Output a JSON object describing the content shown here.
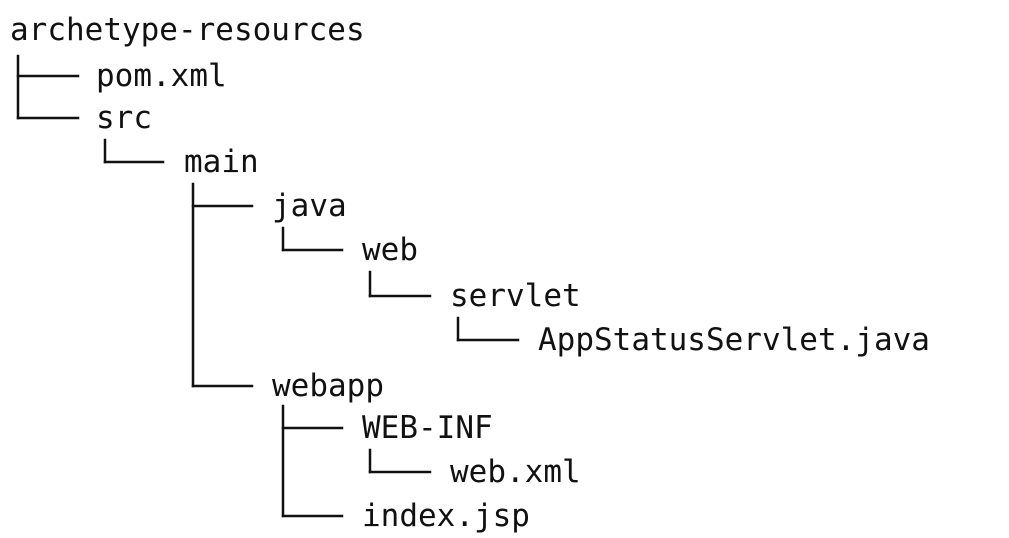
{
  "tree": {
    "root": "archetype-resources",
    "items": [
      {
        "name": "pom.xml"
      },
      {
        "name": "src"
      },
      {
        "name": "main"
      },
      {
        "name": "java"
      },
      {
        "name": "web"
      },
      {
        "name": "servlet"
      },
      {
        "name": "AppStatusServlet.java"
      },
      {
        "name": "webapp"
      },
      {
        "name": "WEB-INF"
      },
      {
        "name": "web.xml"
      },
      {
        "name": "index.jsp"
      }
    ]
  }
}
